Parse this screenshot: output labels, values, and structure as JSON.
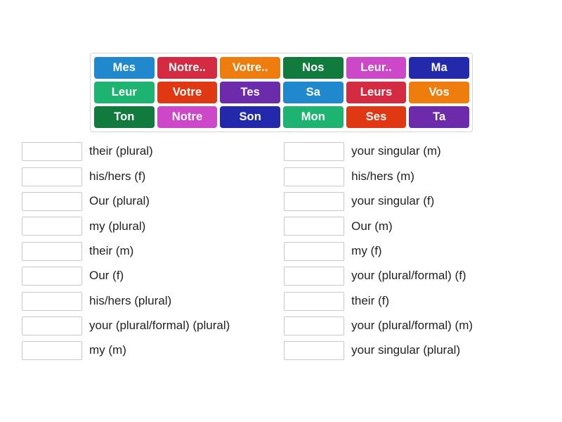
{
  "tile_bank": {
    "name": "french-possessive-adjectives-tile-bank",
    "rows": [
      [
        {
          "label": "Mes",
          "color": "#2089ce"
        },
        {
          "label": "Notre..",
          "color": "#d42b43"
        },
        {
          "label": "Votre..",
          "color": "#ef7d0d"
        },
        {
          "label": "Nos",
          "color": "#117a3d"
        },
        {
          "label": "Leur..",
          "color": "#cc48c9"
        },
        {
          "label": "Ma",
          "color": "#2229ab"
        }
      ],
      [
        {
          "label": "Leur",
          "color": "#1db472"
        },
        {
          "label": "Votre",
          "color": "#df3812"
        },
        {
          "label": "Tes",
          "color": "#6c2bab"
        },
        {
          "label": "Sa",
          "color": "#2089ce"
        },
        {
          "label": "Leurs",
          "color": "#d42b43"
        },
        {
          "label": "Vos",
          "color": "#ef7d0d"
        }
      ],
      [
        {
          "label": "Ton",
          "color": "#117a3d"
        },
        {
          "label": "Notre",
          "color": "#cc48c9"
        },
        {
          "label": "Son",
          "color": "#2229ab"
        },
        {
          "label": "Mon",
          "color": "#1db472"
        },
        {
          "label": "Ses",
          "color": "#df3812"
        },
        {
          "label": "Ta",
          "color": "#6c2bab"
        }
      ]
    ]
  },
  "answers": {
    "slot_value": "",
    "left_column": [
      {
        "prompt": "their (plural)"
      },
      {
        "prompt": "his/hers (f)"
      },
      {
        "prompt": "Our (plural)"
      },
      {
        "prompt": "my (plural)"
      },
      {
        "prompt": "their (m)"
      },
      {
        "prompt": "Our (f)"
      },
      {
        "prompt": "his/hers (plural)"
      },
      {
        "prompt": "your (plural/formal) (plural)"
      },
      {
        "prompt": "my (m)"
      }
    ],
    "right_column": [
      {
        "prompt": "your singular (m)"
      },
      {
        "prompt": "his/hers (m)"
      },
      {
        "prompt": "your singular (f)"
      },
      {
        "prompt": "Our (m)"
      },
      {
        "prompt": "my (f)"
      },
      {
        "prompt": "your (plural/formal) (f)"
      },
      {
        "prompt": "their (f)"
      },
      {
        "prompt": "your (plural/formal) (m)"
      },
      {
        "prompt": "your singular (plural)"
      }
    ]
  }
}
